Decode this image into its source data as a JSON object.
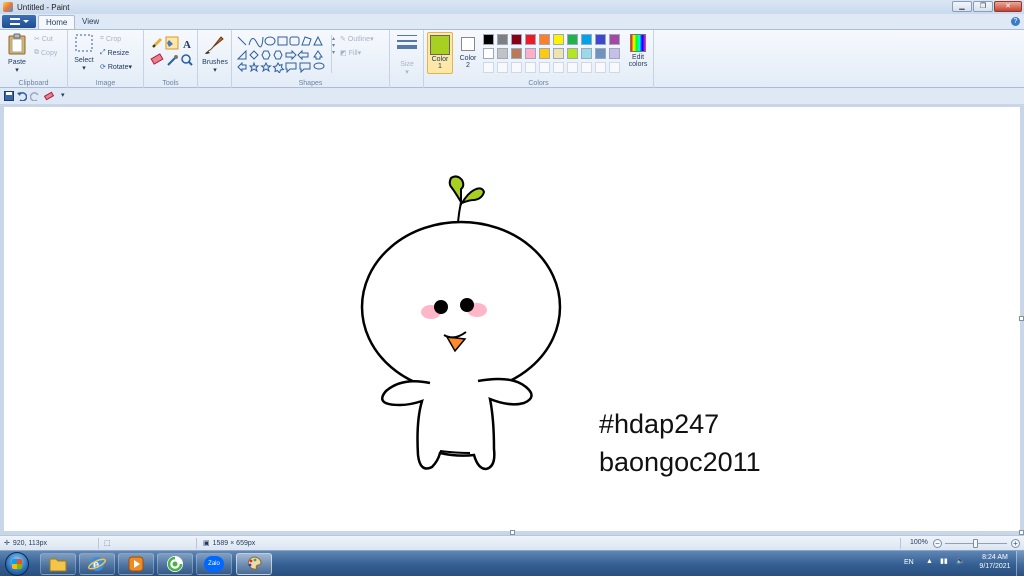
{
  "window": {
    "title": "Untitled - Paint",
    "controls": [
      "minimize",
      "maximize",
      "close"
    ]
  },
  "tabs": [
    {
      "label": "Home",
      "active": true
    },
    {
      "label": "View",
      "active": false
    }
  ],
  "ribbon": {
    "clipboard": {
      "label": "Clipboard",
      "paste": "Paste",
      "cut": "Cut",
      "copy": "Copy"
    },
    "image": {
      "label": "Image",
      "select": "Select",
      "crop": "Crop",
      "resize": "Resize",
      "rotate": "Rotate"
    },
    "tools": {
      "label": "Tools"
    },
    "brushes": {
      "label": "Brushes"
    },
    "shapes": {
      "label": "Shapes",
      "outline": "Outline",
      "fill": "Fill"
    },
    "size": {
      "label": "Size"
    },
    "colors": {
      "label": "Colors",
      "color1": {
        "label": "Color",
        "number": "1",
        "value": "#a8d020"
      },
      "color2": {
        "label": "Color",
        "number": "2",
        "value": "#ffffff"
      },
      "edit": {
        "line1": "Edit",
        "line2": "colors"
      },
      "palette_row1": [
        "#000000",
        "#7f7f7f",
        "#880015",
        "#ed1c24",
        "#ff7f27",
        "#fff200",
        "#22b14c",
        "#00a2e8",
        "#3f48cc",
        "#a349a4"
      ],
      "palette_row2": [
        "#ffffff",
        "#c3c3c3",
        "#b97a57",
        "#ffaec9",
        "#ffc90e",
        "#efe4b0",
        "#b5e61d",
        "#99d9ea",
        "#7092be",
        "#c8bfe7"
      ]
    }
  },
  "canvas": {
    "text_line1": "#hdap247",
    "text_line2": "baongoc2011",
    "drawing": {
      "sprout_color": "#a8d020",
      "blush_color": "#ffb6c8",
      "beak_color": "#ff8a2a"
    }
  },
  "statusbar": {
    "cursor_position": "920, 113px",
    "image_size": "1589 × 659px",
    "zoom": "100%"
  },
  "taskbar": {
    "apps": [
      "Explorer",
      "Internet Explorer",
      "Media Player",
      "Coc Coc",
      "Zalo",
      "Paint"
    ],
    "zalo_label": "Zalo",
    "language": "EN",
    "time": "8:24 AM",
    "date": "9/17/2021"
  }
}
